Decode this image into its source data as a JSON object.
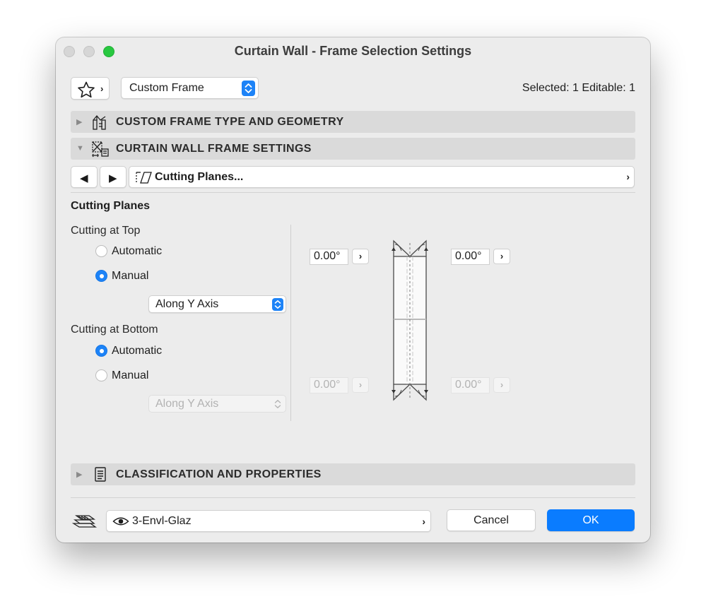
{
  "window": {
    "title": "Curtain Wall - Frame Selection Settings"
  },
  "toolbar": {
    "frame_select": "Custom Frame",
    "selection_info": "Selected: 1 Editable: 1"
  },
  "sections": {
    "type_geometry": "CUSTOM FRAME TYPE AND GEOMETRY",
    "frame_settings": "CURTAIN WALL FRAME SETTINGS",
    "classification": "CLASSIFICATION AND PROPERTIES"
  },
  "page_nav": {
    "current_page": "Cutting Planes..."
  },
  "cutting": {
    "title": "Cutting Planes",
    "top": {
      "label": "Cutting at Top",
      "automatic_label": "Automatic",
      "manual_label": "Manual",
      "selected": "Manual",
      "axis": "Along Y Axis",
      "left_angle": "0.00°",
      "right_angle": "0.00°"
    },
    "bottom": {
      "label": "Cutting at Bottom",
      "automatic_label": "Automatic",
      "manual_label": "Manual",
      "selected": "Automatic",
      "axis": "Along Y Axis",
      "left_angle": "0.00°",
      "right_angle": "0.00°"
    }
  },
  "footer": {
    "layer": "3-Envl-Glaz",
    "cancel_label": "Cancel",
    "ok_label": "OK"
  },
  "colors": {
    "accent": "#0a7cff",
    "section_bg": "#dadada",
    "window_bg": "#ececec"
  }
}
